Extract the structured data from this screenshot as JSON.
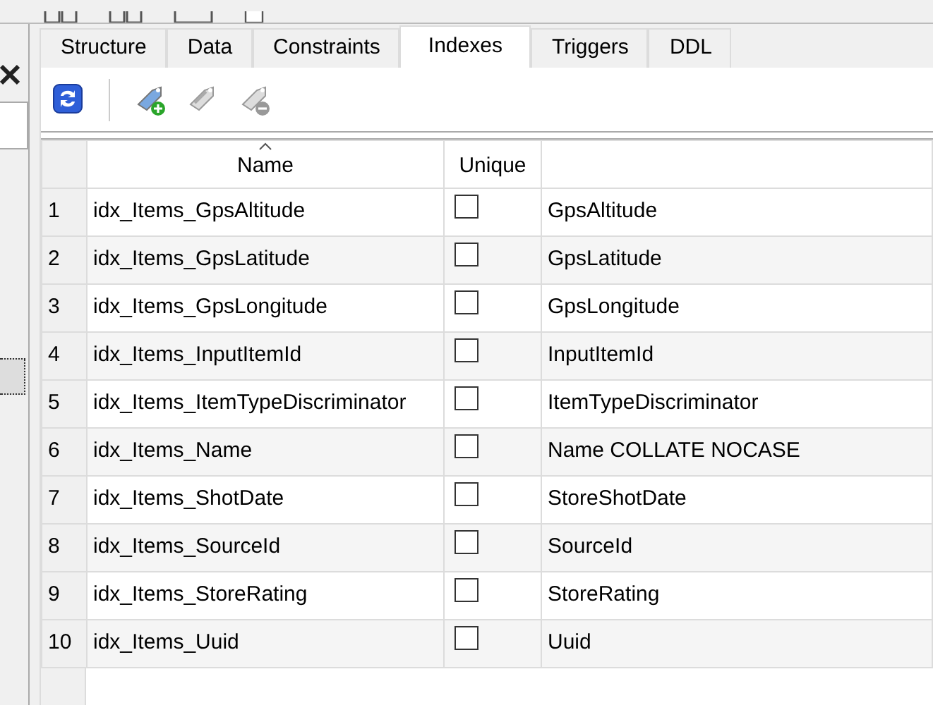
{
  "tabs": [
    {
      "label": "Structure",
      "selected": false
    },
    {
      "label": "Data",
      "selected": false
    },
    {
      "label": "Constraints",
      "selected": false
    },
    {
      "label": "Indexes",
      "selected": true
    },
    {
      "label": "Triggers",
      "selected": false
    },
    {
      "label": "DDL",
      "selected": false
    }
  ],
  "toolbar": [
    {
      "kind": "refresh",
      "disabled": false
    },
    {
      "kind": "add",
      "disabled": false
    },
    {
      "kind": "edit",
      "disabled": true
    },
    {
      "kind": "delete",
      "disabled": true
    }
  ],
  "table": {
    "columns": [
      {
        "label": "Name",
        "sorted": true
      },
      {
        "label": "Unique",
        "sorted": false
      }
    ],
    "rows": [
      {
        "number": "1",
        "name": "idx_Items_GpsAltitude",
        "unique": false,
        "column_3": "GpsAltitude"
      },
      {
        "number": "2",
        "name": "idx_Items_GpsLatitude",
        "unique": false,
        "column_3": "GpsLatitude"
      },
      {
        "number": "3",
        "name": "idx_Items_GpsLongitude",
        "unique": false,
        "column_3": "GpsLongitude"
      },
      {
        "number": "4",
        "name": "idx_Items_InputItemId",
        "unique": false,
        "column_3": "InputItemId"
      },
      {
        "number": "5",
        "name": "idx_Items_ItemTypeDiscriminator",
        "unique": false,
        "column_3": "ItemTypeDiscriminator"
      },
      {
        "number": "6",
        "name": "idx_Items_Name",
        "unique": false,
        "column_3": "Name COLLATE NOCASE"
      },
      {
        "number": "7",
        "name": "idx_Items_ShotDate",
        "unique": false,
        "column_3": "StoreShotDate"
      },
      {
        "number": "8",
        "name": "idx_Items_SourceId",
        "unique": false,
        "column_3": "SourceId"
      },
      {
        "number": "9",
        "name": "idx_Items_StoreRating",
        "unique": false,
        "column_3": "StoreRating"
      },
      {
        "number": "10",
        "name": "idx_Items_Uuid",
        "unique": false,
        "column_3": "Uuid"
      }
    ]
  }
}
